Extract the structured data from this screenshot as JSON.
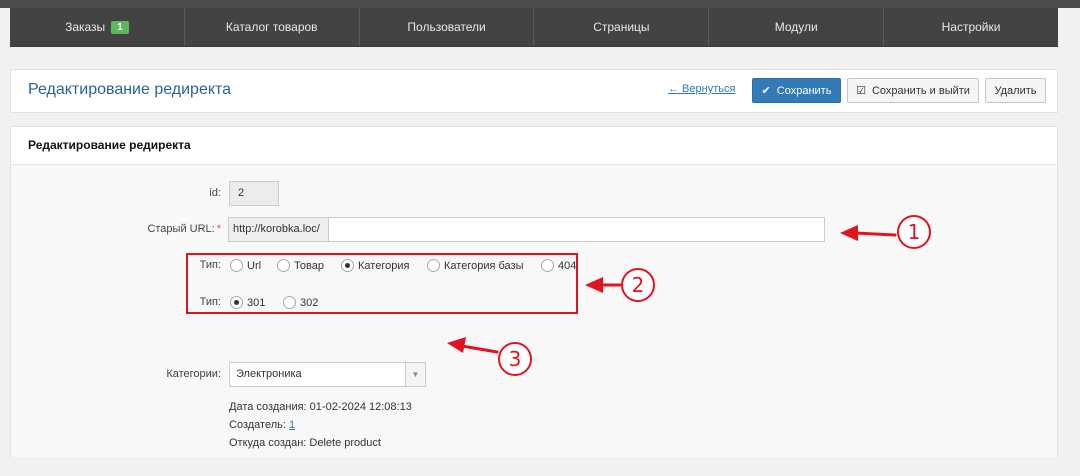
{
  "nav": {
    "items": [
      {
        "label": "Заказы",
        "badge": "1"
      },
      {
        "label": "Каталог товаров"
      },
      {
        "label": "Пользователи"
      },
      {
        "label": "Страницы"
      },
      {
        "label": "Модули"
      },
      {
        "label": "Настройки"
      }
    ]
  },
  "header": {
    "title": "Редактирование редиректа",
    "back_label": "← Вернуться",
    "save_label": "Сохранить",
    "save_exit_label": "Сохранить и выйти",
    "delete_label": "Удалить"
  },
  "form": {
    "heading": "Редактирование редиректа",
    "id_label": "id:",
    "id_value": "2",
    "old_url_label": "Старый URL:",
    "required_mark": "*",
    "url_prefix": "http://korobka.loc/",
    "url_value": "",
    "type_label": "Тип:",
    "type_options": [
      "Url",
      "Товар",
      "Категория",
      "Категория базы",
      "404"
    ],
    "type_selected": "Категория",
    "code_label": "Тип:",
    "code_options": [
      "301",
      "302"
    ],
    "code_selected": "301",
    "category_label": "Категории:",
    "category_value": "Электроника",
    "created_label": "Дата создания:",
    "created_value": "01-02-2024 12:08:13",
    "creator_label": "Создатель:",
    "creator_value": "1",
    "origin_label": "Откуда создан:",
    "origin_value": "Delete product"
  },
  "annotations": [
    "1",
    "2",
    "3"
  ],
  "colors": {
    "accent": "#337ab7",
    "annotation": "#e0141e",
    "badge": "#5cb85c",
    "nav_bg": "#434343"
  }
}
